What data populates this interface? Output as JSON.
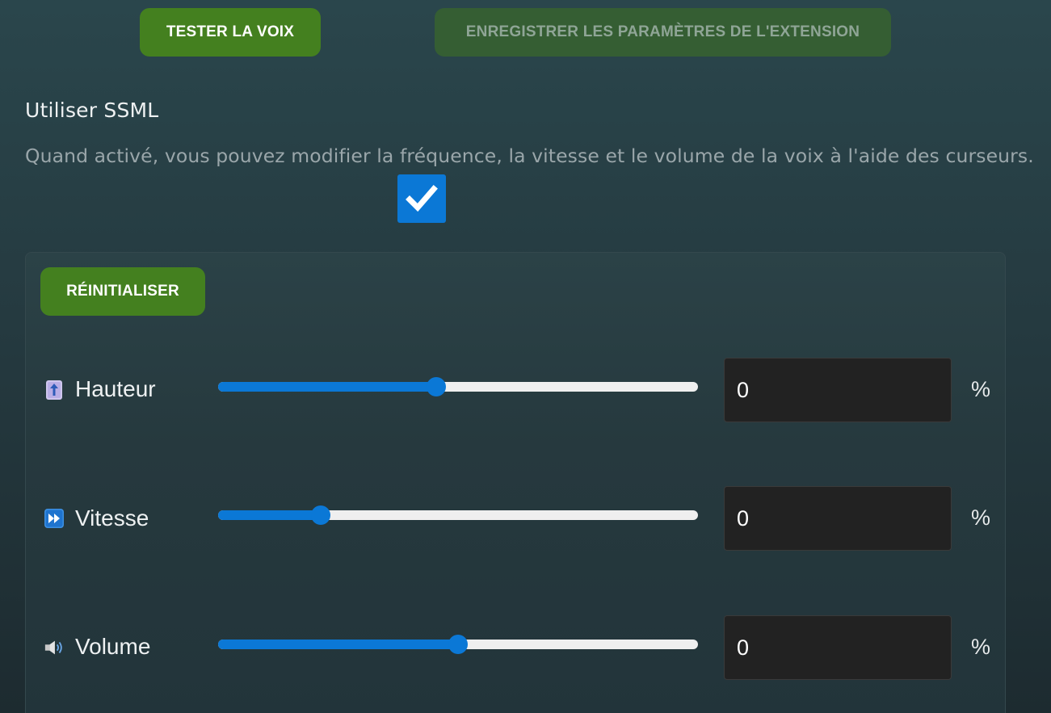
{
  "buttons": {
    "test_voice": "TESTER LA VOIX",
    "save_settings": "ENREGISTRER LES PARAMÈTRES DE L'EXTENSION",
    "reset": "RÉINITIALISER"
  },
  "ssml": {
    "title": "Utiliser SSML",
    "description": "Quand activé, vous pouvez modifier la fréquence, la vitesse et le volume de la voix à l'aide des curseurs.",
    "checked": true
  },
  "sliders": [
    {
      "label": "Hauteur",
      "icon": "pitch-icon",
      "value": "0",
      "unit": "%",
      "position": 0.455
    },
    {
      "label": "Vitesse",
      "icon": "fast-forward-icon",
      "value": "0",
      "unit": "%",
      "position": 0.213
    },
    {
      "label": "Volume",
      "icon": "speaker-icon",
      "value": "0",
      "unit": "%",
      "position": 0.5
    }
  ],
  "colors": {
    "accent": "#0b78d6",
    "primary_button": "#44801f",
    "disabled_button": "#355e33"
  }
}
